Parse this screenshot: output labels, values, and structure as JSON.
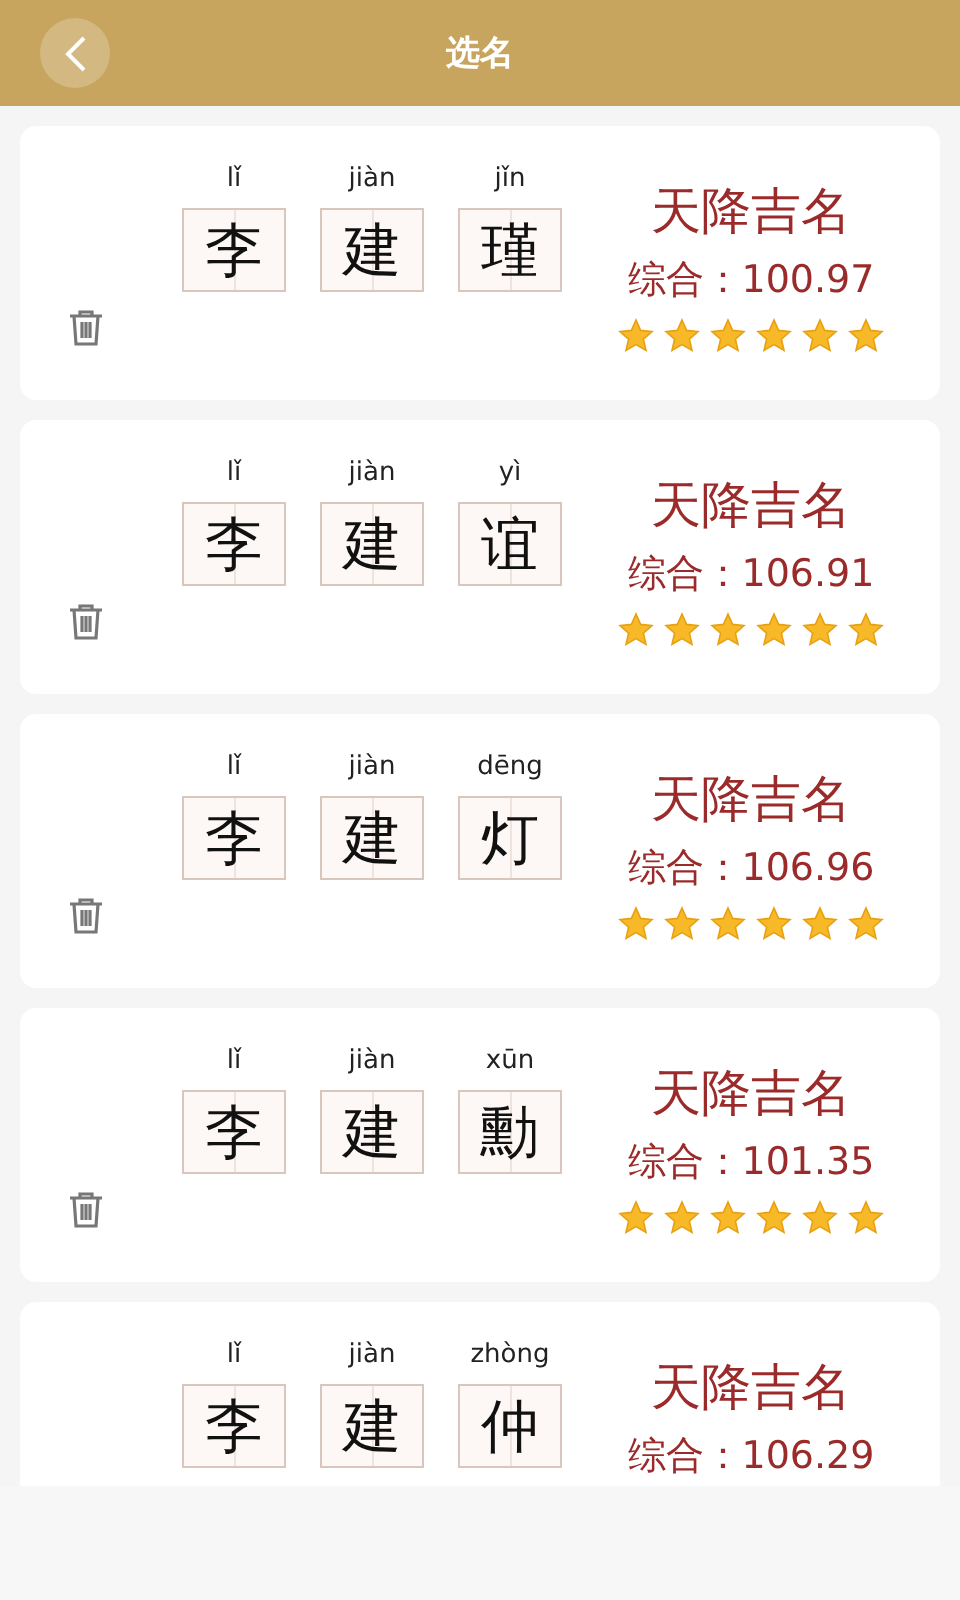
{
  "header": {
    "title": "选名"
  },
  "cards": [
    {
      "characters": [
        {
          "pinyin": "lǐ",
          "hanzi": "李"
        },
        {
          "pinyin": "jiàn",
          "hanzi": "建"
        },
        {
          "pinyin": "jǐn",
          "hanzi": "瑾"
        }
      ],
      "title": "天降吉名",
      "score": "综合：100.97",
      "stars": 6
    },
    {
      "characters": [
        {
          "pinyin": "lǐ",
          "hanzi": "李"
        },
        {
          "pinyin": "jiàn",
          "hanzi": "建"
        },
        {
          "pinyin": "yì",
          "hanzi": "谊"
        }
      ],
      "title": "天降吉名",
      "score": "综合：106.91",
      "stars": 6
    },
    {
      "characters": [
        {
          "pinyin": "lǐ",
          "hanzi": "李"
        },
        {
          "pinyin": "jiàn",
          "hanzi": "建"
        },
        {
          "pinyin": "dēng",
          "hanzi": "灯"
        }
      ],
      "title": "天降吉名",
      "score": "综合：106.96",
      "stars": 6
    },
    {
      "characters": [
        {
          "pinyin": "lǐ",
          "hanzi": "李"
        },
        {
          "pinyin": "jiàn",
          "hanzi": "建"
        },
        {
          "pinyin": "xūn",
          "hanzi": "勳"
        }
      ],
      "title": "天降吉名",
      "score": "综合：101.35",
      "stars": 6
    },
    {
      "characters": [
        {
          "pinyin": "lǐ",
          "hanzi": "李"
        },
        {
          "pinyin": "jiàn",
          "hanzi": "建"
        },
        {
          "pinyin": "zhòng",
          "hanzi": "仲"
        }
      ],
      "title": "天降吉名",
      "score": "综合：106.29"
    }
  ]
}
